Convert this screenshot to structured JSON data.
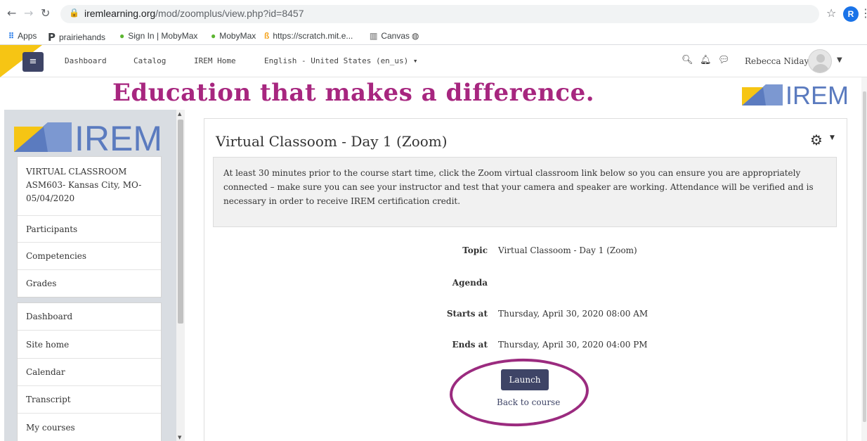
{
  "browser": {
    "url_host": "iremlearning.org",
    "url_path": "/mod/zoomplus/view.php?id=8457",
    "profile_initial": "R",
    "bookmarks": [
      {
        "label": "Apps",
        "icon": "apps-grid-icon"
      },
      {
        "label": "prairiehands",
        "icon": "prairiehands-p-icon"
      },
      {
        "label": "Sign In | MobyMax",
        "icon": "mobymax-leaf-icon"
      },
      {
        "label": "MobyMax",
        "icon": "mobymax-leaf-icon"
      },
      {
        "label": "https://scratch.mit.e...",
        "icon": "scratch-icon"
      },
      {
        "label": "Canvas",
        "icon": "canvas-icon"
      },
      {
        "label": "",
        "icon": "globe-icon"
      }
    ]
  },
  "navbar": {
    "links": [
      "Dashboard",
      "Catalog",
      "IREM Home"
    ],
    "language": "English - United States (en_us) ▾",
    "username": "Rebecca Niday"
  },
  "banner": {
    "tagline": "Education that makes a difference.",
    "logo_text": "IREM"
  },
  "sidebar": {
    "logo_text": "IREM",
    "course": {
      "line1": "VIRTUAL CLASSROOM",
      "line2": "ASM603- Kansas City, MO-",
      "line3": "05/04/2020"
    },
    "course_items": [
      "Participants",
      "Competencies",
      "Grades"
    ],
    "nav_items": [
      "Dashboard",
      "Site home",
      "Calendar",
      "Transcript",
      "My courses"
    ]
  },
  "main": {
    "title": "Virtual Classoom - Day 1 (Zoom)",
    "notice": "At least 30 minutes prior to the course start time, click the Zoom virtual classroom link below so you can ensure you are appropriately connected – make sure you can see your instructor and test that your camera and speaker are working.  Attendance will be verified and is necessary in order to receive IREM certification credit.",
    "details": [
      {
        "label": "Topic",
        "value": "Virtual Classoom - Day 1 (Zoom)"
      },
      {
        "label": "Agenda",
        "value": ""
      },
      {
        "label": "Starts at",
        "value": "Thursday, April 30, 2020 08:00 AM"
      },
      {
        "label": "Ends at",
        "value": "Thursday, April 30, 2020 04:00 PM"
      }
    ],
    "launch_label": "Launch",
    "back_label": "Back to course"
  },
  "colors": {
    "brand_magenta": "#a7267f",
    "button_navy": "#3e4466",
    "accent_yellow": "#f6c514",
    "logo_blue": "#5b7bbf"
  }
}
